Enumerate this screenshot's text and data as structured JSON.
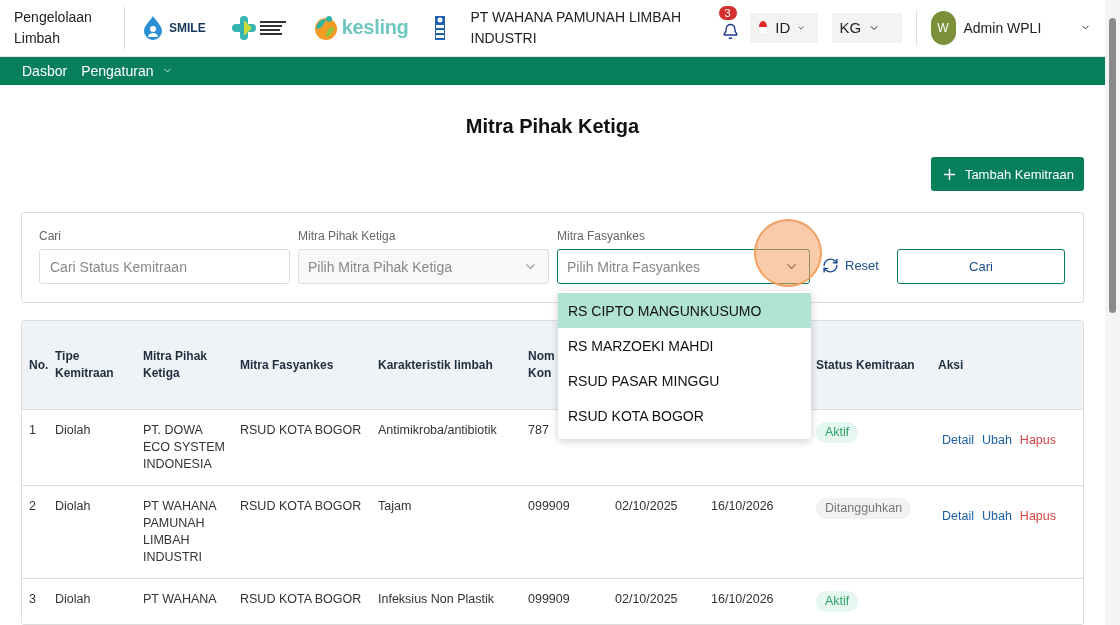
{
  "header": {
    "app_title": "Pengelolaan Limbah",
    "logos": [
      {
        "kind": "smile",
        "text": "SMILE"
      },
      {
        "kind": "kemenkes"
      },
      {
        "kind": "kesling",
        "text": "kesling"
      },
      {
        "kind": "undp"
      }
    ],
    "company": "PT WAHANA PAMUNAH LIMBAH INDUSTRI",
    "notification_count": "3",
    "language": "ID",
    "unit": "KG",
    "user": {
      "initial": "W",
      "name": "Admin WPLI"
    }
  },
  "nav": [
    {
      "label": "Dasbor",
      "dropdown": false
    },
    {
      "label": "Pengaturan",
      "dropdown": true
    }
  ],
  "page_title": "Mitra Pihak Ketiga",
  "add_button": "Tambah Kemitraan",
  "filters": {
    "fields": [
      {
        "label": "Cari",
        "placeholder": "Cari Status Kemitraan",
        "kind": "text",
        "focused": false
      },
      {
        "label": "Mitra Pihak Ketiga",
        "placeholder": "Pilih Mitra Pihak Ketiga",
        "kind": "select",
        "focused": false
      },
      {
        "label": "Mitra Fasyankes",
        "placeholder": "Pilih Mitra Fasyankes",
        "kind": "select",
        "focused": true
      }
    ],
    "reset": "Reset",
    "search_button": "Cari",
    "dropdown_options": [
      {
        "label": "RS CIPTO MANGUNKUSUMO",
        "selected": true
      },
      {
        "label": "RS MARZOEKI MAHDI",
        "selected": false
      },
      {
        "label": "RSUD PASAR MINGGU",
        "selected": false
      },
      {
        "label": "RSUD KOTA BOGOR",
        "selected": false
      }
    ]
  },
  "table": {
    "columns": [
      "No.",
      "Tipe Kemitraan",
      "Mitra Pihak Ketiga",
      "Mitra Fasyankes",
      "Karakteristik limbah",
      "Nom Kon",
      null,
      null,
      "Status Kemitraan",
      "Aksi"
    ],
    "rows": [
      {
        "cells": [
          "1",
          "Diolah",
          "PT. DOWA ECO SYSTEM INDONESIA",
          "RSUD KOTA BOGOR",
          "Antimikroba/antibiotik",
          "787",
          null,
          null
        ],
        "status": {
          "label": "Aktif",
          "kind": "active"
        },
        "actions": [
          "Detail",
          "Ubah",
          "Hapus"
        ]
      },
      {
        "cells": [
          "2",
          "Diolah",
          "PT WAHANA PAMUNAH LIMBAH INDUSTRI",
          "RSUD KOTA BOGOR",
          "Tajam",
          "099909",
          "02/10/2025",
          "16/10/2026"
        ],
        "status": {
          "label": "Ditangguhkan",
          "kind": "suspended"
        },
        "actions": [
          "Detail",
          "Ubah",
          "Hapus"
        ]
      },
      {
        "cells": [
          "3",
          "Diolah",
          "PT WAHANA",
          "RSUD KOTA BOGOR",
          "Infeksius Non Plastik",
          "099909",
          "02/10/2025",
          "16/10/2026"
        ],
        "status": {
          "label": "Aktif",
          "kind": "active"
        },
        "actions": []
      }
    ]
  }
}
